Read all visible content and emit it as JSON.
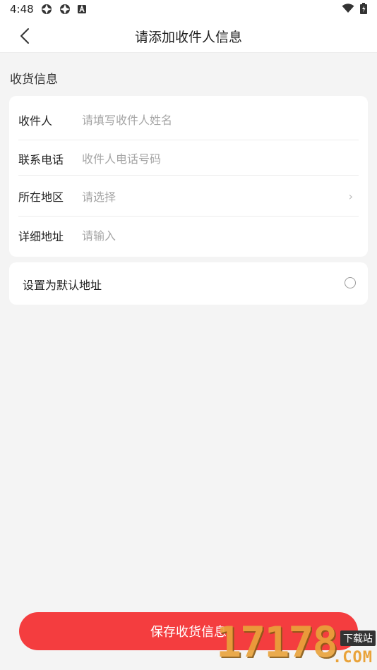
{
  "status_bar": {
    "time": "4:48",
    "icons": [
      "app-icon",
      "app-icon",
      "a-icon",
      "wifi-icon",
      "battery-icon"
    ]
  },
  "header": {
    "title": "请添加收件人信息",
    "back_icon": "chevron-left-icon"
  },
  "section": {
    "title": "收货信息"
  },
  "form": {
    "recipient": {
      "label": "收件人",
      "placeholder": "请填写收件人姓名"
    },
    "phone": {
      "label": "联系电话",
      "placeholder": "收件人电话号码"
    },
    "region": {
      "label": "所在地区",
      "placeholder": "请选择"
    },
    "address": {
      "label": "详细地址",
      "placeholder": "请输入"
    }
  },
  "default_address": {
    "label": "设置为默认地址",
    "checked": false
  },
  "save_button": {
    "label": "保存收货信息"
  },
  "watermark": {
    "number": "17178",
    "site": "下载站",
    "domain": ".COM"
  },
  "colors": {
    "accent": "#f43d3f",
    "background": "#f4f4f4",
    "placeholder": "#a6a6a6"
  }
}
